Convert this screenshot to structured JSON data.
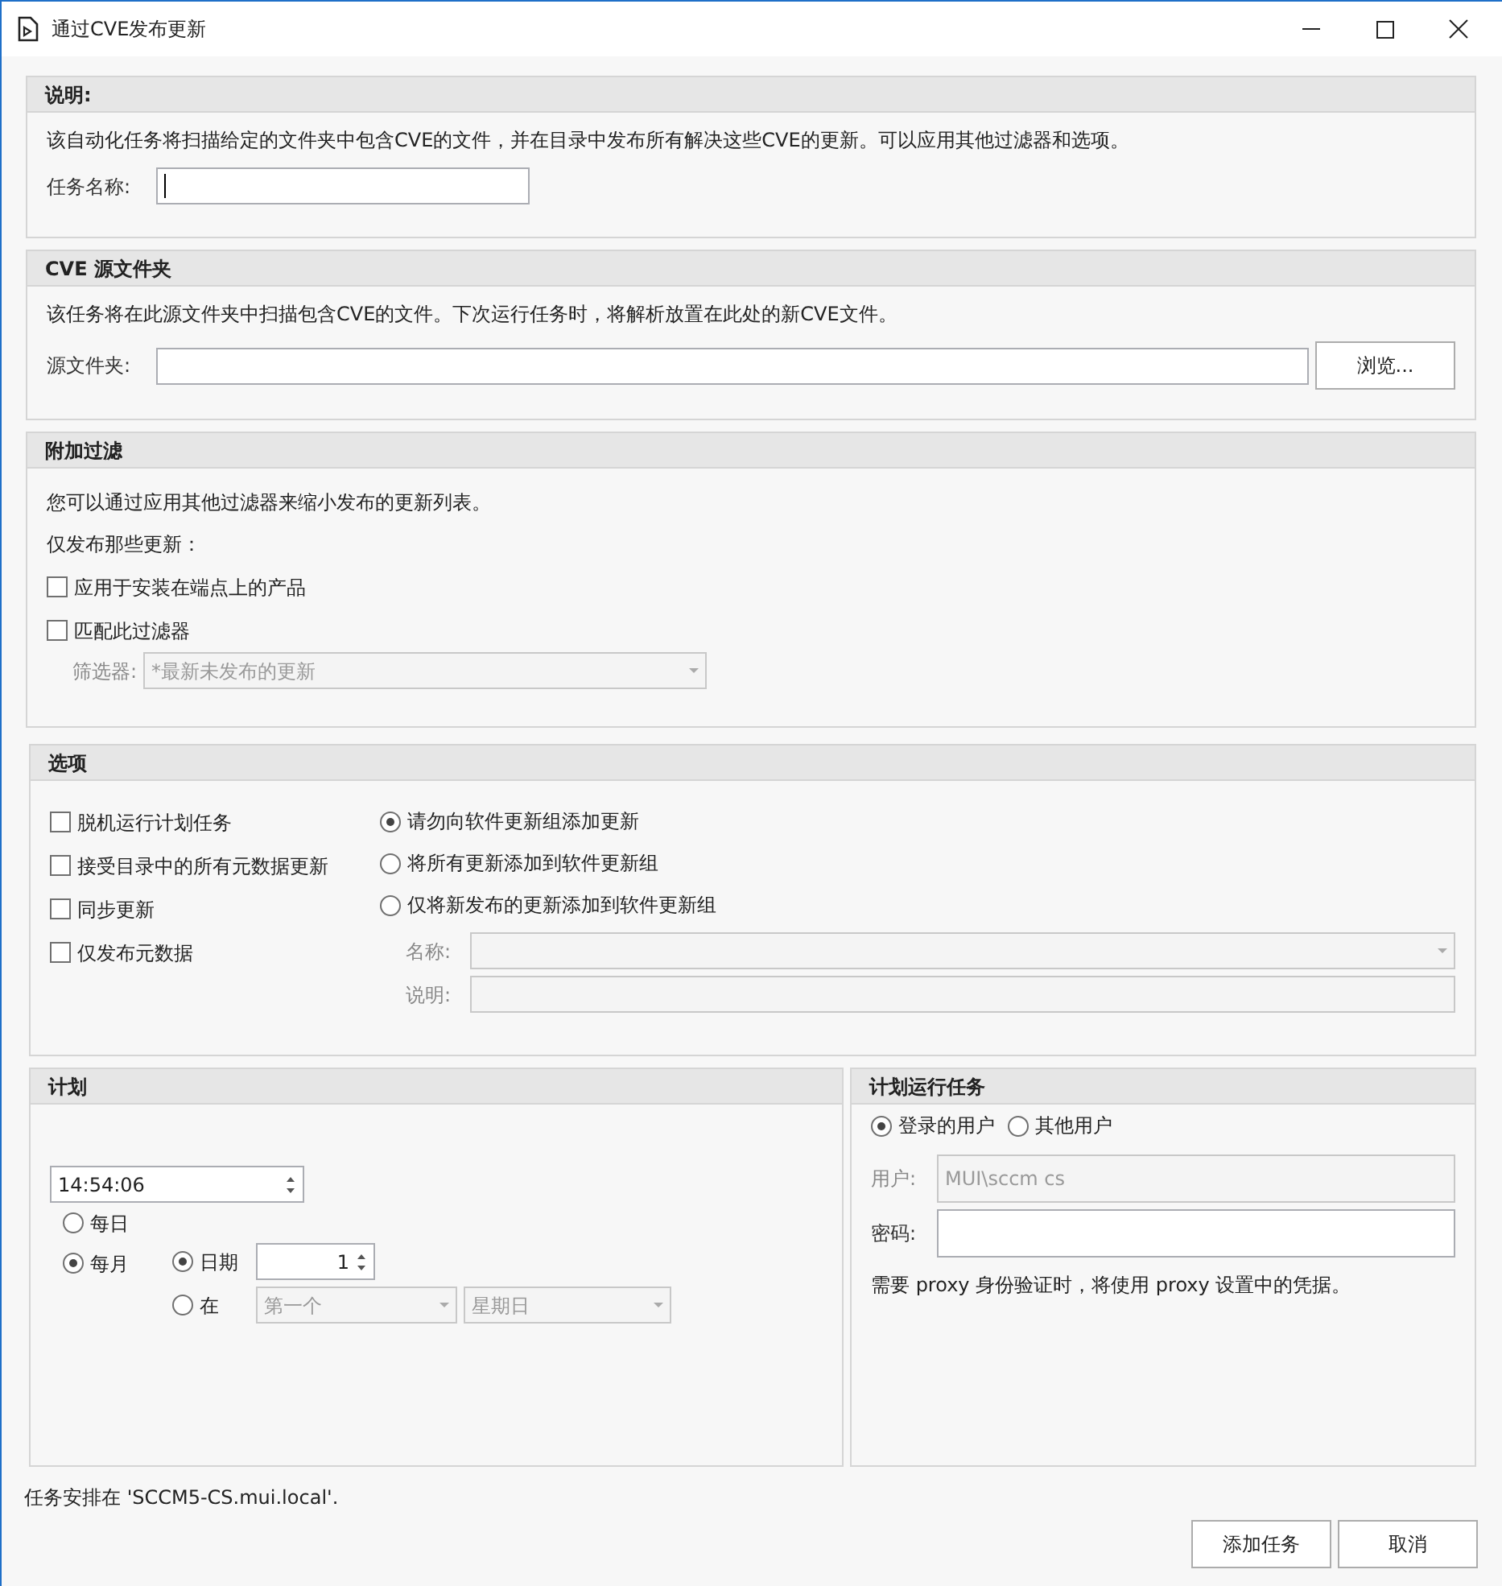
{
  "window": {
    "title": "通过CVE发布更新"
  },
  "description": {
    "title": "说明:",
    "text": "该自动化任务将扫描给定的文件夹中包含CVE的文件，并在目录中发布所有解决这些CVE的更新。可以应用其他过滤器和选项。",
    "task_name_label": "任务名称:"
  },
  "source": {
    "title": "CVE 源文件夹",
    "text": "该任务将在此源文件夹中扫描包含CVE的文件。下次运行任务时，将解析放置在此处的新CVE文件。",
    "folder_label": "源文件夹:",
    "browse_button": "浏览..."
  },
  "filters": {
    "title": "附加过滤",
    "text": "您可以通过应用其他过滤器来缩小发布的更新列表。",
    "subtitle": "仅发布那些更新：",
    "checkboxes": [
      {
        "label": "应用于安装在端点上的产品",
        "checked": false
      },
      {
        "label": "匹配此过滤器",
        "checked": false
      }
    ],
    "filter": {
      "label": "筛选器:",
      "value": "*最新未发布的更新",
      "disabled": true
    }
  },
  "options": {
    "title": "选项",
    "checkboxes": [
      {
        "label": "脱机运行计划任务",
        "checked": false
      },
      {
        "label": "接受目录中的所有元数据更新",
        "checked": false
      },
      {
        "label": "同步更新",
        "checked": false
      },
      {
        "label": "仅发布元数据",
        "checked": false
      }
    ],
    "radios": [
      {
        "label": "请勿向软件更新组添加更新",
        "selected": true
      },
      {
        "label": "将所有更新添加到软件更新组",
        "selected": false
      },
      {
        "label": "仅将新发布的更新添加到软件更新组",
        "selected": false
      }
    ],
    "name": {
      "label": "名称:",
      "disabled": true
    },
    "comment": {
      "label": "说明:",
      "disabled": true
    }
  },
  "schedule": {
    "title": "计划",
    "time": "14:54:06",
    "frequency": [
      {
        "label": "每日",
        "selected": false
      },
      {
        "label": "每月",
        "selected": true
      }
    ],
    "monthly": [
      {
        "label": "日期",
        "selected": true
      },
      {
        "label": "在",
        "selected": false
      }
    ],
    "day": "1",
    "week": "第一个",
    "weekday": "星期日"
  },
  "run_as": {
    "title": "计划运行任务",
    "accounts": [
      {
        "label": "登录的用户",
        "selected": true
      },
      {
        "label": "其他用户",
        "selected": false
      }
    ],
    "user": {
      "label": "用户:",
      "value": "MUI\\sccm cs",
      "disabled": true
    },
    "password_label": "密码:",
    "note": "需要 proxy 身份验证时，将使用 proxy 设置中的凭据。"
  },
  "status": "任务安排在 'SCCM5-CS.mui.local'.",
  "buttons": [
    "添加任务",
    "取消"
  ]
}
